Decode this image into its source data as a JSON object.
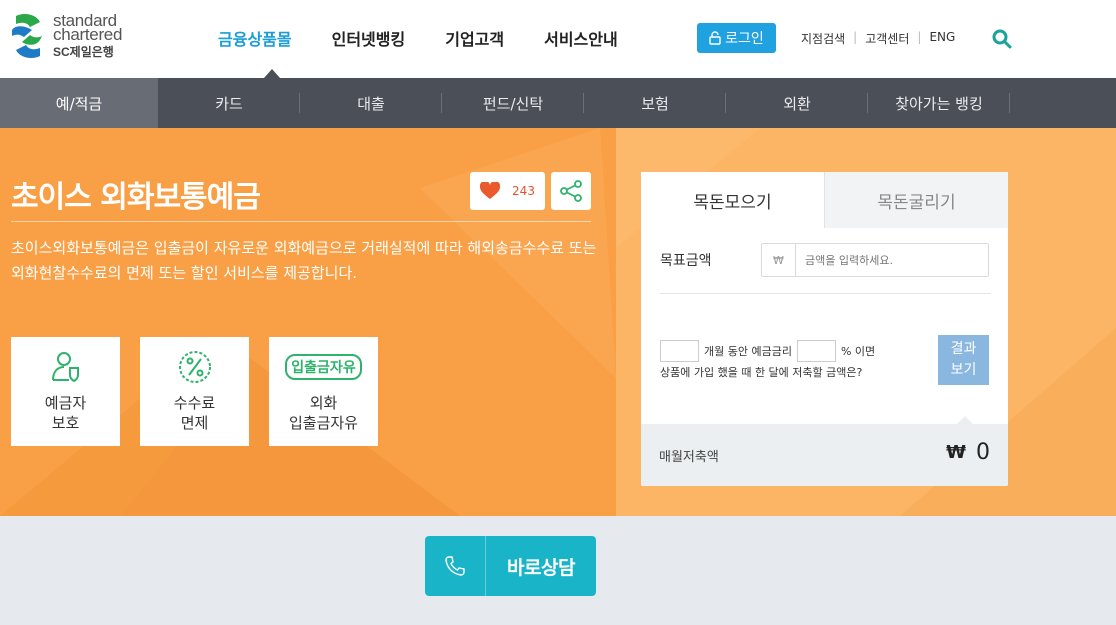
{
  "logo": {
    "line1": "standard",
    "line2": "chartered",
    "line3": "SC제일은행"
  },
  "gnb": {
    "items": [
      "금융상품몰",
      "인터넷뱅킹",
      "기업고객",
      "서비스안내"
    ]
  },
  "header": {
    "login_label": "로그인",
    "util": [
      "지점검색",
      "고객센터",
      "ENG"
    ]
  },
  "lnb": {
    "items": [
      "예/적금",
      "카드",
      "대출",
      "펀드/신탁",
      "보험",
      "외환",
      "찾아가는 뱅킹"
    ]
  },
  "product": {
    "title": "초이스 외화보통예금",
    "like_count": "243",
    "description": "초이스외화보통예금은 입출금이 자유로운 외화예금으로 거래실적에 따라 해외송금수수료 또는 외화현찰수수료의 면제 또는 할인 서비스를 제공합니다.",
    "features": [
      {
        "label": "예금자\n보호"
      },
      {
        "label": "수수료\n면제"
      },
      {
        "chip": "입출금자유",
        "label": "외화\n입출금자유"
      }
    ]
  },
  "calculator": {
    "tab_active": "목돈모으기",
    "tab_inactive": "목돈굴리기",
    "goal_label": "목표금액",
    "currency_symbol": "₩",
    "goal_placeholder": "금액을 입력하세요.",
    "q_months": "개월 동안 예금금리",
    "q_rate": "% 이면",
    "q_line2": "상품에 가입 했을 때 한 달에 저축할 금액은?",
    "result_label": "결과\n보기",
    "monthly_label": "매월저축액",
    "monthly_currency": "₩",
    "monthly_value": "0"
  },
  "consult": {
    "label": "바로상담"
  },
  "colors": {
    "accent_blue": "#1fa2df",
    "hero_orange": "#f9a046",
    "green": "#2db36b",
    "teal": "#1ab4c9",
    "nav_dark": "#4b4f57"
  }
}
